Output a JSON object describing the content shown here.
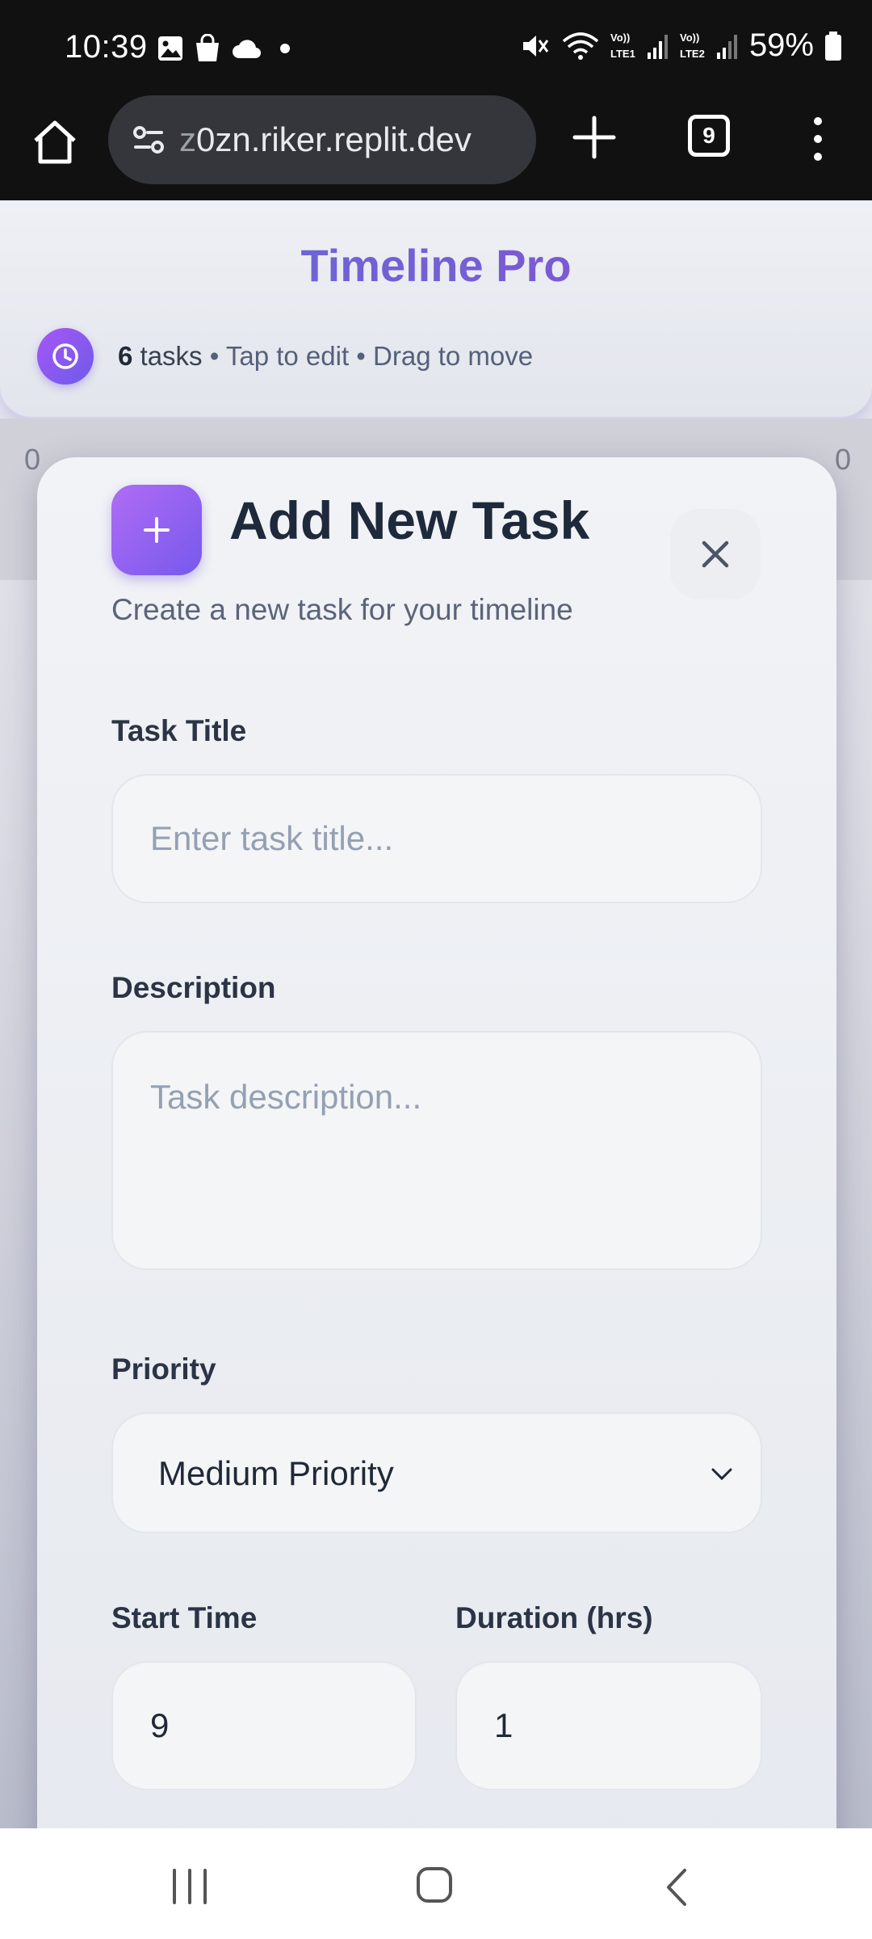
{
  "status_bar": {
    "time": "10:39",
    "battery": "59%",
    "icons": [
      "image-icon",
      "bag-icon",
      "cloud-icon",
      "dot-icon",
      "mute-icon",
      "wifi-icon",
      "signal-lte1-icon",
      "signal-lte2-icon",
      "battery-icon"
    ]
  },
  "browser": {
    "url_fade": "z",
    "url": "0zn.riker.replit.dev",
    "tab_count": "9"
  },
  "header": {
    "title": "Timeline Pro",
    "task_count": "6",
    "tasks_word": "tasks",
    "hint": "• Tap to edit • Drag to move"
  },
  "background_peek": {
    "left_char": "0",
    "right_char": "0"
  },
  "modal": {
    "title": "Add New Task",
    "subtitle": "Create a new task for your timeline",
    "fields": {
      "title_label": "Task Title",
      "title_placeholder": "Enter task title...",
      "description_label": "Description",
      "description_placeholder": "Task description...",
      "priority_label": "Priority",
      "priority_value": "Medium Priority",
      "start_label": "Start Time",
      "start_value": "9",
      "duration_label": "Duration (hrs)",
      "duration_value": "1"
    }
  },
  "colors": {
    "accent_start": "#a855f7",
    "accent_end": "#6d5ce8",
    "title_gradient_start": "#5f6fd8",
    "title_gradient_end": "#8a4fd0"
  }
}
